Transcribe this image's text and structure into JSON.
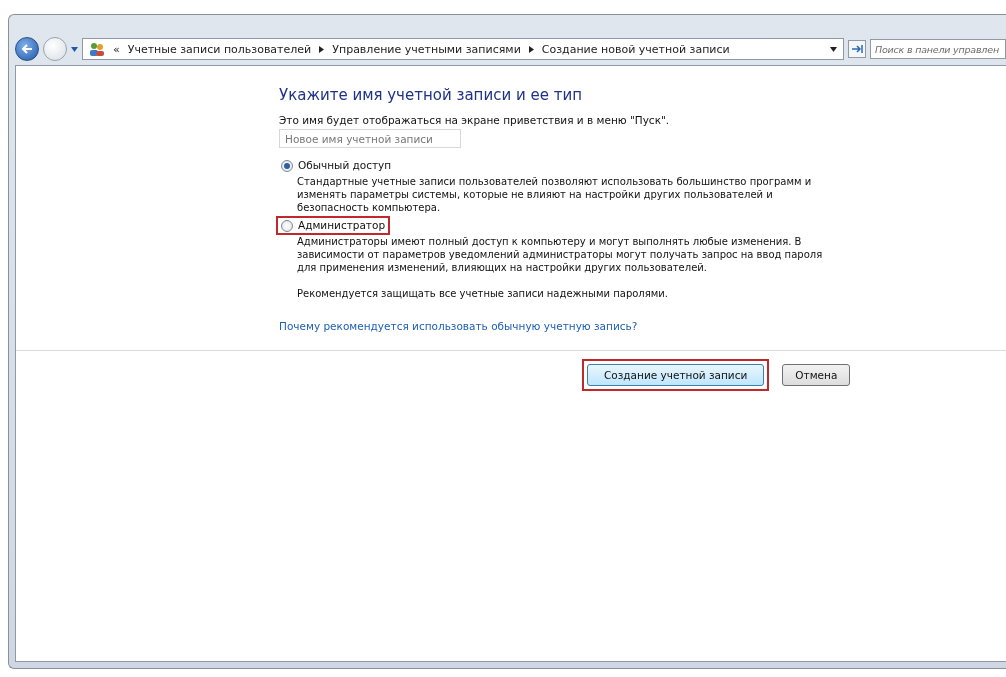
{
  "address_bar": {
    "breadcrumbs": [
      "Учетные записи пользователей",
      "Управление учетными записями",
      "Создание новой учетной записи"
    ],
    "overflow": "«"
  },
  "search": {
    "placeholder": "Поиск в панели управлен"
  },
  "heading": "Укажите имя учетной записи и ее тип",
  "name_hint": "Это имя будет отображаться на экране приветствия и в меню \"Пуск\".",
  "name_field": {
    "placeholder": "Новое имя учетной записи"
  },
  "account_types": [
    {
      "label": "Обычный доступ",
      "selected": true,
      "highlighted": false,
      "description": [
        "Стандартные учетные записи пользователей позволяют использовать большинство программ и изменять параметры системы, которые не влияют на настройки других пользователей и безопасность компьютера."
      ]
    },
    {
      "label": "Администратор",
      "selected": false,
      "highlighted": true,
      "description": [
        "Администраторы имеют полный доступ к компьютеру и могут выполнять любые изменения. В зависимости от параметров уведомлений администраторы могут получать запрос на ввод пароля для применения изменений, влияющих на настройки других пользователей.",
        "Рекомендуется защищать все учетные записи надежными паролями."
      ]
    }
  ],
  "help_link": "Почему рекомендуется использовать обычную учетную запись?",
  "buttons": [
    {
      "label": "Создание учетной записи",
      "highlighted": true,
      "default": true
    },
    {
      "label": "Отмена",
      "highlighted": false,
      "default": false
    }
  ]
}
